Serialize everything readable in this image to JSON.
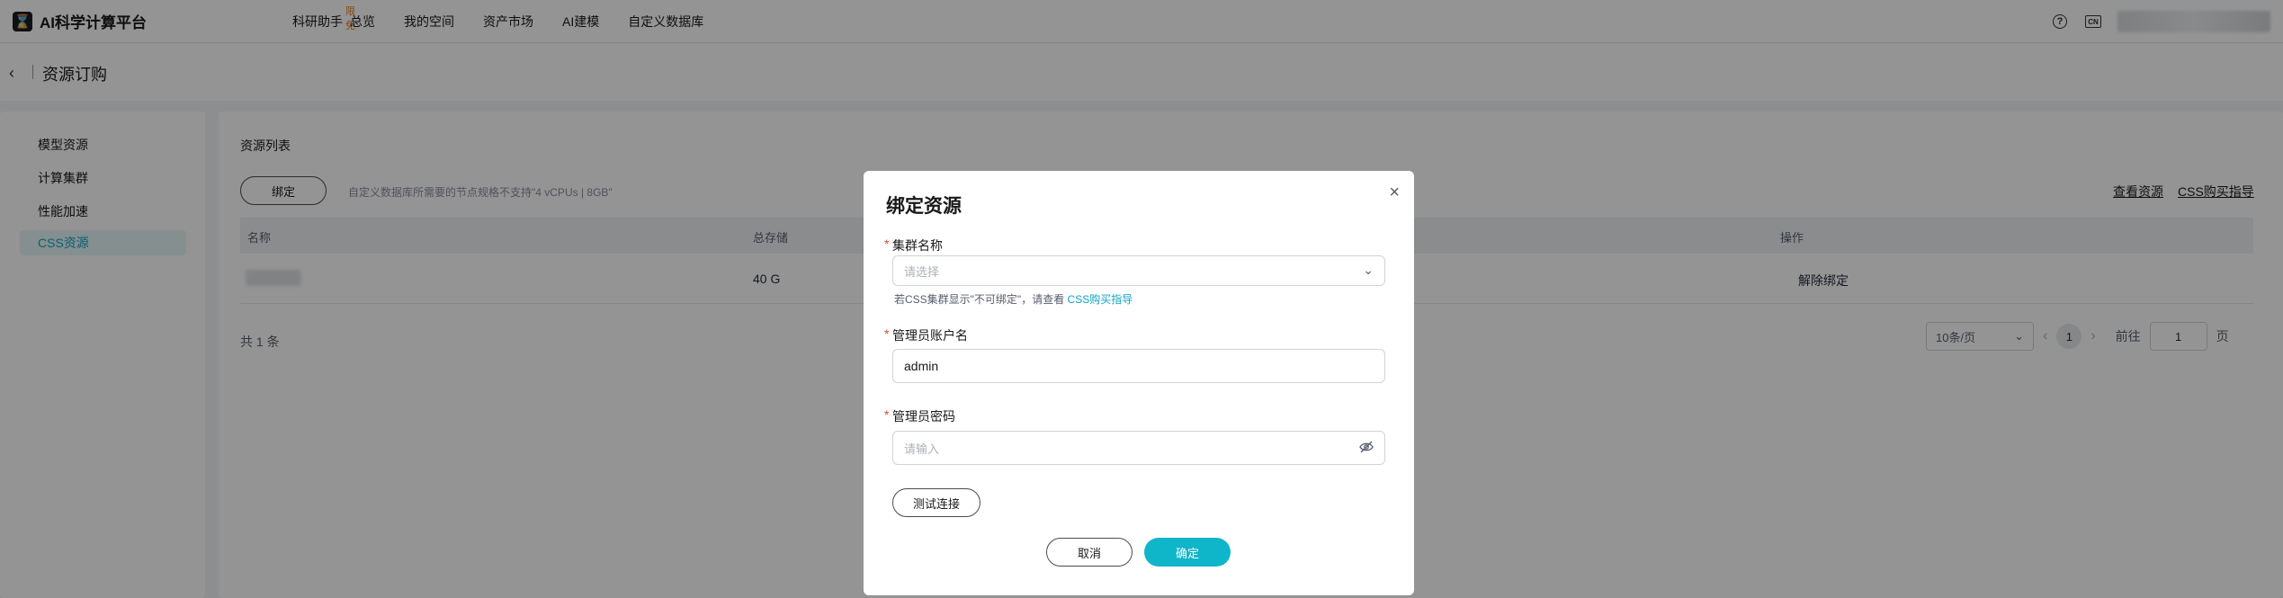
{
  "app": {
    "logo_glyph": "⌛",
    "name": "AI科学计算平台"
  },
  "nav": {
    "items": [
      {
        "label": "科研助手",
        "badge": "限免"
      },
      {
        "label": "总览"
      },
      {
        "label": "我的空间"
      },
      {
        "label": "资产市场"
      },
      {
        "label": "AI建模"
      },
      {
        "label": "自定义数据库"
      }
    ],
    "help_glyph": "?",
    "lang_label": "CN"
  },
  "page": {
    "back_glyph": "‹",
    "title": "资源订购"
  },
  "sidebar": {
    "items": [
      {
        "label": "模型资源"
      },
      {
        "label": "计算集群"
      },
      {
        "label": "性能加速"
      },
      {
        "label": "CSS资源",
        "active": true
      }
    ]
  },
  "main": {
    "section_title": "资源列表",
    "bind_button": "绑定",
    "bind_hint": "自定义数据库所需要的节点规格不支持\"4 vCPUs | 8GB\"",
    "links": {
      "view": "查看资源",
      "guide": "CSS购买指导"
    },
    "table": {
      "headers": [
        "名称",
        "总存储",
        "操作"
      ],
      "rows": [
        {
          "storage": "40 G",
          "action": "解除绑定"
        }
      ]
    },
    "total": "共 1 条",
    "pagination": {
      "page_size": "10条/页",
      "current": "1",
      "goto_label": "前往",
      "goto_value": "1",
      "unit": "页"
    }
  },
  "modal": {
    "title": "绑定资源",
    "close_glyph": "×",
    "cluster": {
      "label": "集群名称",
      "placeholder": "请选择",
      "hint_text": "若CSS集群显示\"不可绑定\"，请查看 ",
      "hint_link": "CSS购买指导"
    },
    "admin_user": {
      "label": "管理员账户名",
      "value": "admin"
    },
    "admin_password": {
      "label": "管理员密码",
      "placeholder": "请输入"
    },
    "test_button": "测试连接",
    "cancel_button": "取消",
    "ok_button": "确定"
  },
  "colors": {
    "accent": "#0fb5c9",
    "link": "#0fa5c1",
    "required": "#e2463b",
    "badge": "#e37b1c"
  }
}
